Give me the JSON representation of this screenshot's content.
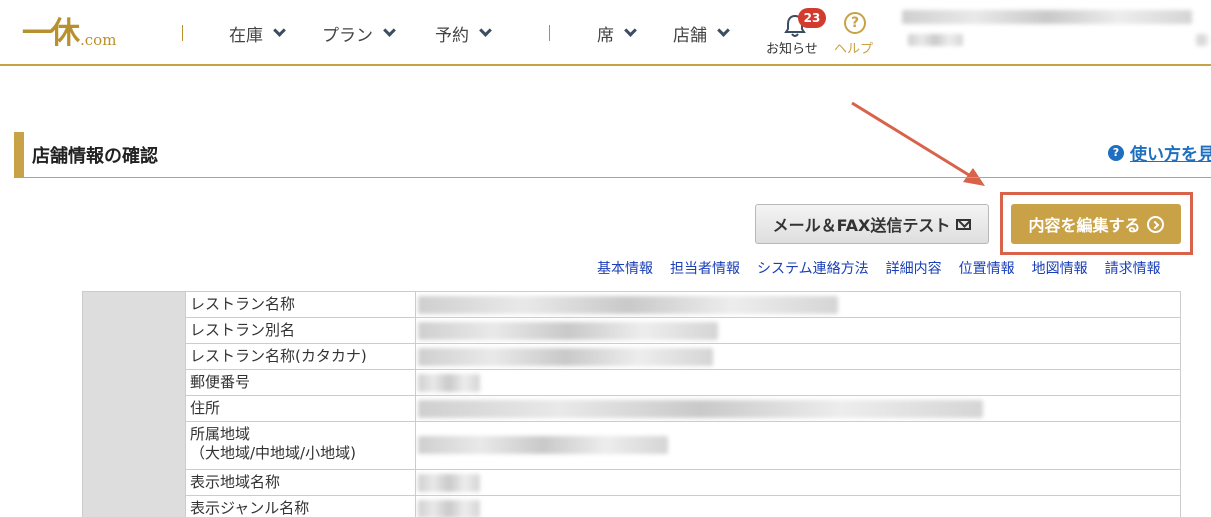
{
  "header": {
    "logo_main": "一休",
    "logo_sub": ".com",
    "nav": [
      {
        "label": "在庫"
      },
      {
        "label": "プラン"
      },
      {
        "label": "予約"
      },
      {
        "label": "席"
      },
      {
        "label": "店舗"
      }
    ],
    "notice_label": "お知らせ",
    "notice_count": "23",
    "help_label": "ヘルプ"
  },
  "page": {
    "title": "店舗情報の確認",
    "howto_link": "使い方を見"
  },
  "buttons": {
    "mail_test": "メール＆FAX送信テスト",
    "edit": "内容を編集する"
  },
  "anchors": [
    "基本情報",
    "担当者情報",
    "システム連絡方法",
    "詳細内容",
    "位置情報",
    "地図情報",
    "請求情報"
  ],
  "table": {
    "rows": [
      {
        "label": "レストラン名称"
      },
      {
        "label": "レストラン別名"
      },
      {
        "label": "レストラン名称(カタカナ)"
      },
      {
        "label": "郵便番号"
      },
      {
        "label": "住所"
      },
      {
        "label": "所属地域",
        "label2": "（大地域/中地域/小地域)"
      },
      {
        "label": "表示地域名称"
      },
      {
        "label": "表示ジャンル名称"
      }
    ]
  },
  "colors": {
    "brand_gold": "#c9a247",
    "link_blue": "#1a3fb8",
    "badge_red": "#d23b2e",
    "highlight": "#d9624a"
  }
}
